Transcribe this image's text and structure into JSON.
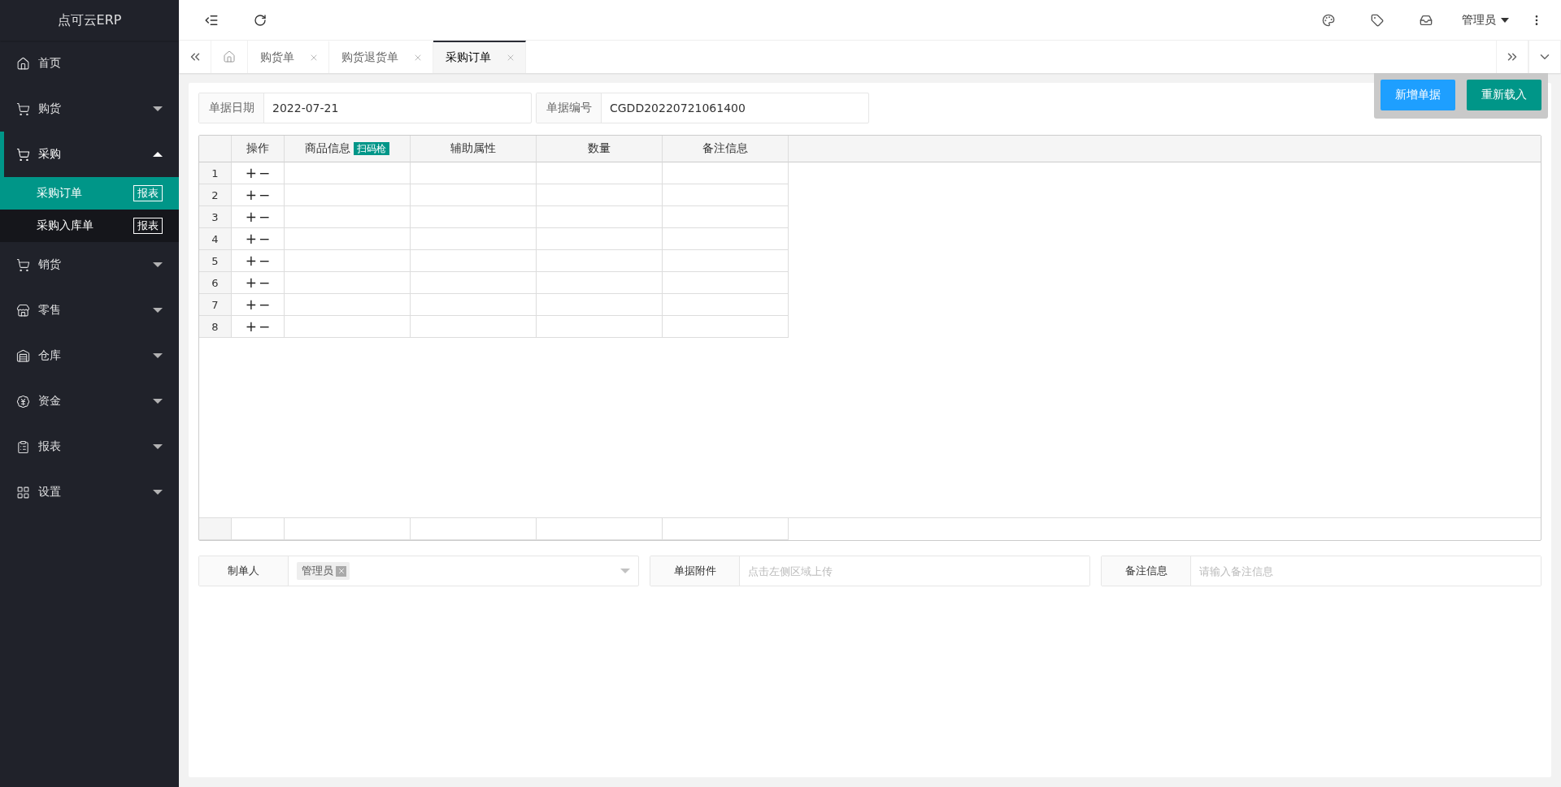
{
  "sidebar": {
    "logo": "点可云ERP",
    "items": [
      {
        "label": "首页",
        "selected": false
      },
      {
        "label": "购货",
        "selected": false,
        "expanded": false,
        "has_children": true
      },
      {
        "label": "采购",
        "selected": true,
        "expanded": true,
        "has_children": true,
        "children": [
          {
            "label": "采购订单",
            "badge": "报表",
            "selected": true
          },
          {
            "label": "采购入库单",
            "badge": "报表",
            "selected": false
          }
        ]
      },
      {
        "label": "销货",
        "selected": false,
        "expanded": false,
        "has_children": true
      },
      {
        "label": "零售",
        "selected": false,
        "expanded": false,
        "has_children": true
      },
      {
        "label": "仓库",
        "selected": false,
        "expanded": false,
        "has_children": true
      },
      {
        "label": "资金",
        "selected": false,
        "expanded": false,
        "has_children": true
      },
      {
        "label": "报表",
        "selected": false,
        "expanded": false,
        "has_children": true
      },
      {
        "label": "设置",
        "selected": false,
        "expanded": false,
        "has_children": true
      }
    ]
  },
  "header": {
    "user": "管理员"
  },
  "tabs": [
    {
      "label": "购货单",
      "selected": false
    },
    {
      "label": "购货退货单",
      "selected": false
    },
    {
      "label": "采购订单",
      "selected": true
    }
  ],
  "actions": [
    {
      "label": "新增单据",
      "kind": "primary"
    },
    {
      "label": "重新载入",
      "kind": "secondary"
    }
  ],
  "form": {
    "date_label": "单据日期",
    "date": "2022-07-21",
    "number_label": "单据编号",
    "number": "CGDD20220721061400"
  },
  "table": {
    "columns": [
      "操作",
      "商品信息",
      "辅助属性",
      "数量",
      "备注信息"
    ],
    "scan_badge": "扫码枪",
    "rows": [
      {
        "number": "1",
        "add": "+",
        "remove": "−"
      },
      {
        "number": "2",
        "add": "+",
        "remove": "−"
      },
      {
        "number": "3",
        "add": "+",
        "remove": "−"
      },
      {
        "number": "4",
        "add": "+",
        "remove": "−"
      },
      {
        "number": "5",
        "add": "+",
        "remove": "−"
      },
      {
        "number": "6",
        "add": "+",
        "remove": "−"
      },
      {
        "number": "7",
        "add": "+",
        "remove": "−"
      },
      {
        "number": "8",
        "add": "+",
        "remove": "−"
      }
    ]
  },
  "footer": {
    "maker_label": "制单人",
    "maker": "管理员",
    "attachment_label": "单据附件",
    "attachment_placeholder": "点击左侧区域上传",
    "note_label": "备注信息",
    "note_placeholder": "请输入备注信息"
  }
}
